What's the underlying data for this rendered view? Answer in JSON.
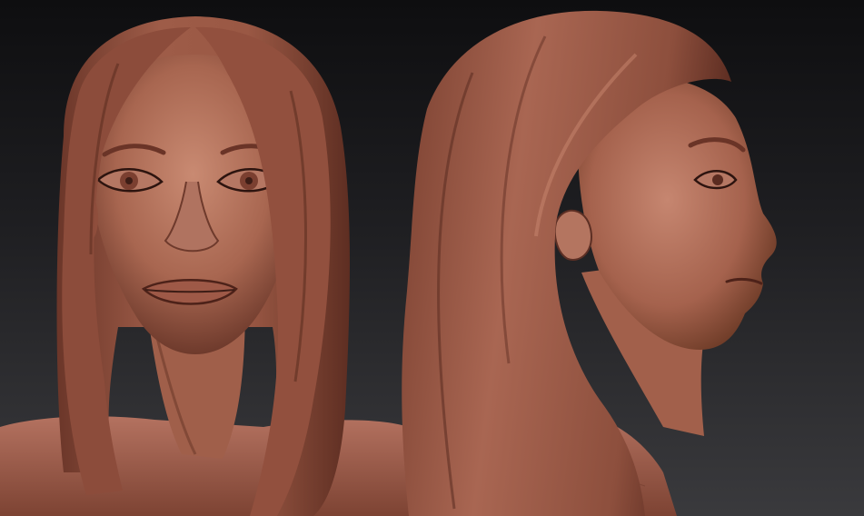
{
  "scene": {
    "views": [
      {
        "id": "front",
        "label": ""
      },
      {
        "id": "side",
        "label": ""
      }
    ],
    "colors": {
      "background_top": "#0e0e10",
      "background_bottom": "#3a3a3d",
      "clay_base": "#a86650",
      "clay_light": "#c98a72",
      "clay_shadow": "#5c2f24",
      "clay_dark": "#3d1d16"
    }
  }
}
